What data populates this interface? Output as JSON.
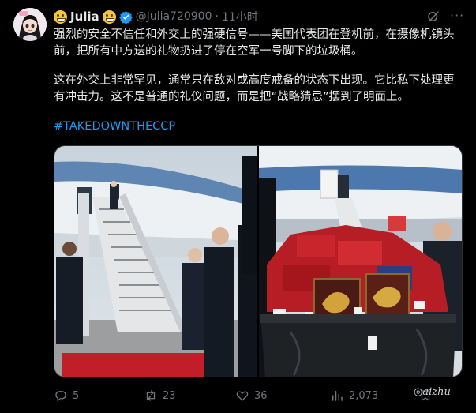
{
  "author": {
    "name": "Julia",
    "handle": "@Julia720900",
    "separator": "·",
    "time": "11小时",
    "avatar_icon": "avatar-anime-girl",
    "badge_icon": "verified-badge-icon",
    "emoji_icon": "grinning-emoji-icon"
  },
  "tweet": {
    "paragraph1": "强烈的安全不信任和外交上的强硬信号——美国代表团在登机前，在摄像机镜头前，把所有中方送的礼物扔进了停在空军一号脚下的垃圾桶。",
    "paragraph2": "这在外交上非常罕见，通常只在敌对或高度戒备的状态下出现。它比私下处理更有冲击力。这不是普通的礼仪问题，而是把“战略猜忌”摆到了明面上。",
    "hashtag": "#TAKEDOWNTHECCP"
  },
  "media": {
    "photo1": "air-force-one-stairs-photo",
    "photo2": "gifts-in-trash-bin-photo"
  },
  "actions": {
    "reply_count": "5",
    "retweet_count": "23",
    "like_count": "36",
    "view_count": "2,073"
  },
  "watermark": "aizhu",
  "colors": {
    "background": "#000000",
    "text": "#e7e9ea",
    "muted": "#71767b",
    "link": "#1d9bf0",
    "verified": "#1d9bf0"
  }
}
